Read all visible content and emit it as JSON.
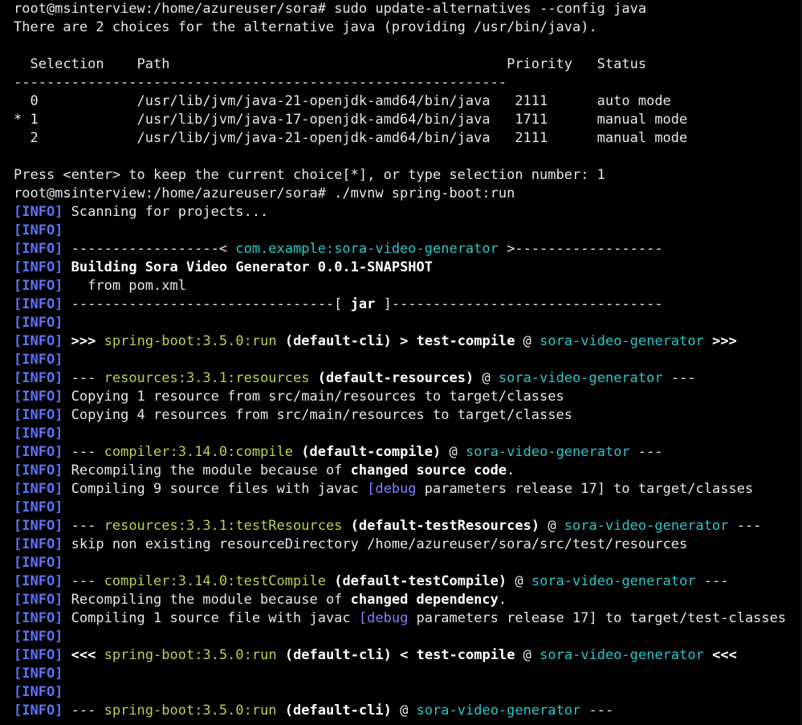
{
  "terminal": {
    "background": "#000000",
    "colors": {
      "text": "#e6e6e6",
      "info_tag": "#5d73f5",
      "artifact": "#2bc6c9",
      "plugin": "#b8d24c",
      "debug": "#7f7fff",
      "bold": "#ffffff"
    },
    "lines": [
      [
        {
          "s": "plain",
          "t": "root@msinterview:/home/azureuser/sora# sudo update-alternatives --config java"
        }
      ],
      [
        {
          "s": "plain",
          "t": "There are 2 choices for the alternative java (providing /usr/bin/java)."
        }
      ],
      [
        {
          "s": "plain",
          "t": ""
        }
      ],
      [
        {
          "s": "plain",
          "t": "  Selection    Path                                         Priority   Status"
        }
      ],
      [
        {
          "s": "plain",
          "t": "------------------------------------------------------------"
        }
      ],
      [
        {
          "s": "plain",
          "t": "  0            /usr/lib/jvm/java-21-openjdk-amd64/bin/java   2111      auto mode"
        }
      ],
      [
        {
          "s": "plain",
          "t": "* 1            /usr/lib/jvm/java-17-openjdk-amd64/bin/java   1711      manual mode"
        }
      ],
      [
        {
          "s": "plain",
          "t": "  2            /usr/lib/jvm/java-21-openjdk-amd64/bin/java   2111      manual mode"
        }
      ],
      [
        {
          "s": "plain",
          "t": ""
        }
      ],
      [
        {
          "s": "plain",
          "t": "Press <enter> to keep the current choice[*], or type selection number: 1"
        }
      ],
      [
        {
          "s": "plain",
          "t": "root@msinterview:/home/azureuser/sora# ./mvnw spring-boot:run"
        }
      ],
      [
        {
          "s": "info",
          "t": "[INFO]"
        },
        {
          "s": "plain",
          "t": " Scanning for projects..."
        }
      ],
      [
        {
          "s": "info",
          "t": "[INFO]"
        }
      ],
      [
        {
          "s": "info",
          "t": "[INFO]"
        },
        {
          "s": "plain",
          "t": " ------------------< "
        },
        {
          "s": "cyan",
          "t": "com.example:sora-video-generator"
        },
        {
          "s": "plain",
          "t": " >------------------"
        }
      ],
      [
        {
          "s": "info",
          "t": "[INFO]"
        },
        {
          "s": "plain",
          "t": " "
        },
        {
          "s": "bold",
          "t": "Building Sora Video Generator 0.0.1-SNAPSHOT"
        }
      ],
      [
        {
          "s": "info",
          "t": "[INFO]"
        },
        {
          "s": "plain",
          "t": "   from pom.xml"
        }
      ],
      [
        {
          "s": "info",
          "t": "[INFO]"
        },
        {
          "s": "plain",
          "t": " --------------------------------[ "
        },
        {
          "s": "bold",
          "t": "jar"
        },
        {
          "s": "plain",
          "t": " ]---------------------------------"
        }
      ],
      [
        {
          "s": "info",
          "t": "[INFO]"
        }
      ],
      [
        {
          "s": "info",
          "t": "[INFO]"
        },
        {
          "s": "plain",
          "t": " "
        },
        {
          "s": "bold",
          "t": ">>>"
        },
        {
          "s": "plain",
          "t": " "
        },
        {
          "s": "green",
          "t": "spring-boot:3.5.0:run"
        },
        {
          "s": "plain",
          "t": " "
        },
        {
          "s": "bold",
          "t": "(default-cli)"
        },
        {
          "s": "plain",
          "t": " "
        },
        {
          "s": "bold",
          "t": "> test-compile"
        },
        {
          "s": "plain",
          "t": " @ "
        },
        {
          "s": "cyan",
          "t": "sora-video-generator"
        },
        {
          "s": "plain",
          "t": " "
        },
        {
          "s": "bold",
          "t": ">>>"
        }
      ],
      [
        {
          "s": "info",
          "t": "[INFO]"
        }
      ],
      [
        {
          "s": "info",
          "t": "[INFO]"
        },
        {
          "s": "plain",
          "t": " --- "
        },
        {
          "s": "green",
          "t": "resources:3.3.1:resources"
        },
        {
          "s": "plain",
          "t": " "
        },
        {
          "s": "bold",
          "t": "(default-resources)"
        },
        {
          "s": "plain",
          "t": " @ "
        },
        {
          "s": "cyan",
          "t": "sora-video-generator"
        },
        {
          "s": "plain",
          "t": " ---"
        }
      ],
      [
        {
          "s": "info",
          "t": "[INFO]"
        },
        {
          "s": "plain",
          "t": " Copying 1 resource from src/main/resources to target/classes"
        }
      ],
      [
        {
          "s": "info",
          "t": "[INFO]"
        },
        {
          "s": "plain",
          "t": " Copying 4 resources from src/main/resources to target/classes"
        }
      ],
      [
        {
          "s": "info",
          "t": "[INFO]"
        }
      ],
      [
        {
          "s": "info",
          "t": "[INFO]"
        },
        {
          "s": "plain",
          "t": " --- "
        },
        {
          "s": "green",
          "t": "compiler:3.14.0:compile"
        },
        {
          "s": "plain",
          "t": " "
        },
        {
          "s": "bold",
          "t": "(default-compile)"
        },
        {
          "s": "plain",
          "t": " @ "
        },
        {
          "s": "cyan",
          "t": "sora-video-generator"
        },
        {
          "s": "plain",
          "t": " ---"
        }
      ],
      [
        {
          "s": "info",
          "t": "[INFO]"
        },
        {
          "s": "plain",
          "t": " Recompiling the module because of "
        },
        {
          "s": "bold",
          "t": "changed source code"
        },
        {
          "s": "plain",
          "t": "."
        }
      ],
      [
        {
          "s": "info",
          "t": "[INFO]"
        },
        {
          "s": "plain",
          "t": " Compiling 9 source files with javac "
        },
        {
          "s": "debug",
          "t": "[debug"
        },
        {
          "s": "plain",
          "t": " parameters release 17] to target/classes"
        }
      ],
      [
        {
          "s": "info",
          "t": "[INFO]"
        }
      ],
      [
        {
          "s": "info",
          "t": "[INFO]"
        },
        {
          "s": "plain",
          "t": " --- "
        },
        {
          "s": "green",
          "t": "resources:3.3.1:testResources"
        },
        {
          "s": "plain",
          "t": " "
        },
        {
          "s": "bold",
          "t": "(default-testResources)"
        },
        {
          "s": "plain",
          "t": " @ "
        },
        {
          "s": "cyan",
          "t": "sora-video-generator"
        },
        {
          "s": "plain",
          "t": " ---"
        }
      ],
      [
        {
          "s": "info",
          "t": "[INFO]"
        },
        {
          "s": "plain",
          "t": " skip non existing resourceDirectory /home/azureuser/sora/src/test/resources"
        }
      ],
      [
        {
          "s": "info",
          "t": "[INFO]"
        }
      ],
      [
        {
          "s": "info",
          "t": "[INFO]"
        },
        {
          "s": "plain",
          "t": " --- "
        },
        {
          "s": "green",
          "t": "compiler:3.14.0:testCompile"
        },
        {
          "s": "plain",
          "t": " "
        },
        {
          "s": "bold",
          "t": "(default-testCompile)"
        },
        {
          "s": "plain",
          "t": " @ "
        },
        {
          "s": "cyan",
          "t": "sora-video-generator"
        },
        {
          "s": "plain",
          "t": " ---"
        }
      ],
      [
        {
          "s": "info",
          "t": "[INFO]"
        },
        {
          "s": "plain",
          "t": " Recompiling the module because of "
        },
        {
          "s": "bold",
          "t": "changed dependency"
        },
        {
          "s": "plain",
          "t": "."
        }
      ],
      [
        {
          "s": "info",
          "t": "[INFO]"
        },
        {
          "s": "plain",
          "t": " Compiling 1 source file with javac "
        },
        {
          "s": "debug",
          "t": "[debug"
        },
        {
          "s": "plain",
          "t": " parameters release 17] to target/test-classes"
        }
      ],
      [
        {
          "s": "info",
          "t": "[INFO]"
        }
      ],
      [
        {
          "s": "info",
          "t": "[INFO]"
        },
        {
          "s": "plain",
          "t": " "
        },
        {
          "s": "bold",
          "t": "<<<"
        },
        {
          "s": "plain",
          "t": " "
        },
        {
          "s": "green",
          "t": "spring-boot:3.5.0:run"
        },
        {
          "s": "plain",
          "t": " "
        },
        {
          "s": "bold",
          "t": "(default-cli)"
        },
        {
          "s": "plain",
          "t": " "
        },
        {
          "s": "bold",
          "t": "< test-compile"
        },
        {
          "s": "plain",
          "t": " @ "
        },
        {
          "s": "cyan",
          "t": "sora-video-generator"
        },
        {
          "s": "plain",
          "t": " "
        },
        {
          "s": "bold",
          "t": "<<<"
        }
      ],
      [
        {
          "s": "info",
          "t": "[INFO]"
        }
      ],
      [
        {
          "s": "info",
          "t": "[INFO]"
        }
      ],
      [
        {
          "s": "info",
          "t": "[INFO]"
        },
        {
          "s": "plain",
          "t": " --- "
        },
        {
          "s": "green",
          "t": "spring-boot:3.5.0:run"
        },
        {
          "s": "plain",
          "t": " "
        },
        {
          "s": "bold",
          "t": "(default-cli)"
        },
        {
          "s": "plain",
          "t": " @ "
        },
        {
          "s": "cyan",
          "t": "sora-video-generator"
        },
        {
          "s": "plain",
          "t": " ---"
        }
      ]
    ]
  }
}
